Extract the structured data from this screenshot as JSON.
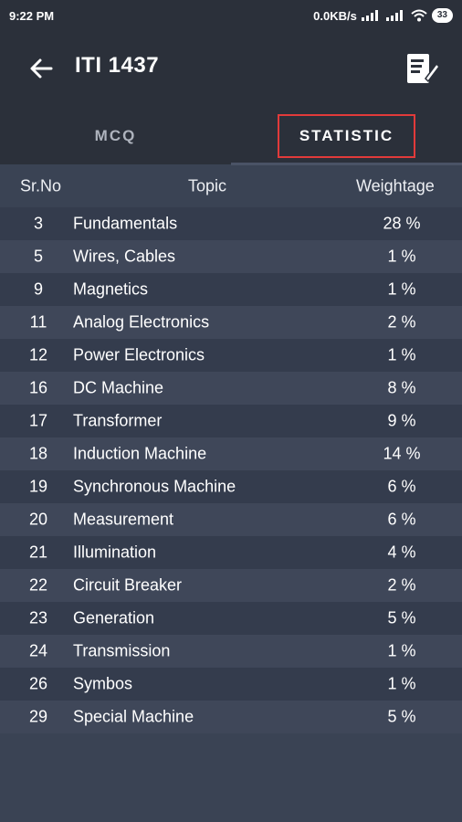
{
  "status": {
    "time": "9:22 PM",
    "speed": "0.0KB/s",
    "battery": "33"
  },
  "appbar": {
    "title": "ITI 1437"
  },
  "tabs": {
    "mcq": "MCQ",
    "statistic": "STATISTIC"
  },
  "table": {
    "headers": {
      "sr": "Sr.No",
      "topic": "Topic",
      "weightage": "Weightage"
    },
    "rows": [
      {
        "sr": "3",
        "topic": "Fundamentals",
        "w": "28 %"
      },
      {
        "sr": "5",
        "topic": "Wires, Cables",
        "w": "1 %"
      },
      {
        "sr": "9",
        "topic": "Magnetics",
        "w": "1 %"
      },
      {
        "sr": "11",
        "topic": "Analog Electronics",
        "w": "2 %"
      },
      {
        "sr": "12",
        "topic": "Power Electronics",
        "w": "1 %"
      },
      {
        "sr": "16",
        "topic": "DC Machine",
        "w": "8 %"
      },
      {
        "sr": "17",
        "topic": "Transformer",
        "w": "9 %"
      },
      {
        "sr": "18",
        "topic": "Induction Machine",
        "w": "14 %"
      },
      {
        "sr": "19",
        "topic": "Synchronous Machine",
        "w": "6 %"
      },
      {
        "sr": "20",
        "topic": "Measurement",
        "w": "6 %"
      },
      {
        "sr": "21",
        "topic": "Illumination",
        "w": "4 %"
      },
      {
        "sr": "22",
        "topic": "Circuit Breaker",
        "w": "2 %"
      },
      {
        "sr": "23",
        "topic": "Generation",
        "w": "5 %"
      },
      {
        "sr": "24",
        "topic": "Transmission",
        "w": "1 %"
      },
      {
        "sr": "26",
        "topic": "Symbos",
        "w": "1 %"
      },
      {
        "sr": "29",
        "topic": "Special Machine",
        "w": "5 %"
      }
    ]
  },
  "colors": {
    "background": "#3a4354",
    "header": "#2b303a",
    "highlight_border": "#e23a3a"
  },
  "icons": {
    "back": "arrow-left-icon",
    "doc": "document-edit-icon",
    "wifi": "wifi-icon",
    "signal": "signal-icon",
    "battery": "battery-icon"
  }
}
